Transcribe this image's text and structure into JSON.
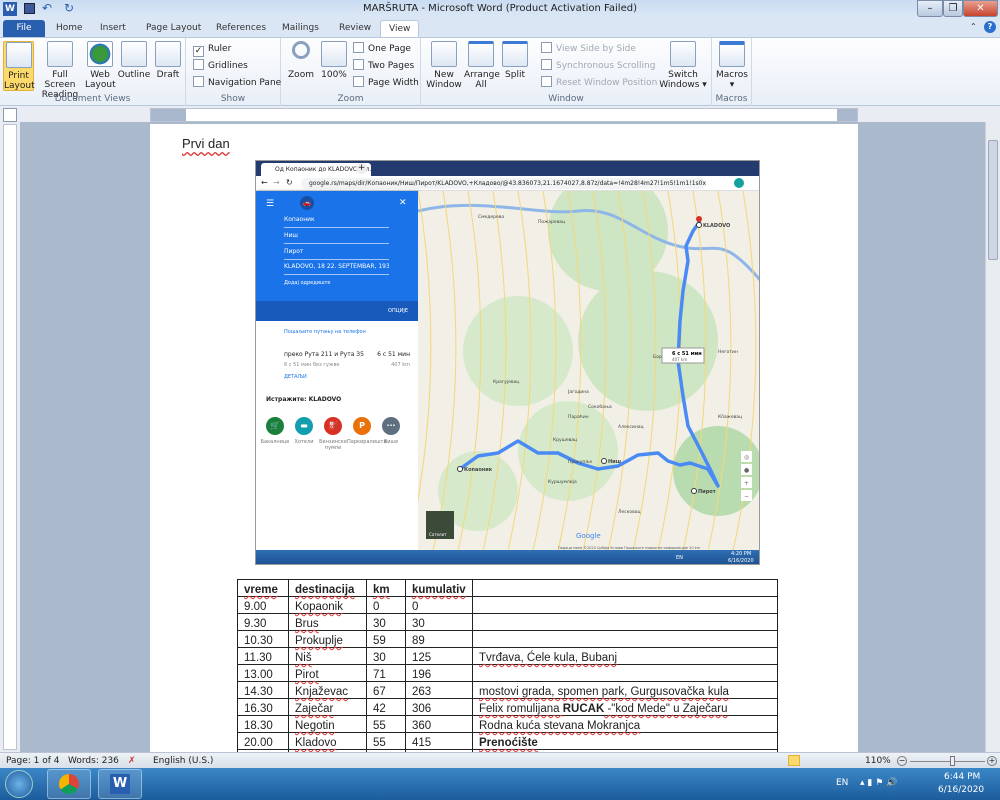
{
  "window": {
    "title": "MARŠRUTA  -  Microsoft Word (Product Activation Failed)",
    "minimize": "–",
    "restore": "❐",
    "close": "✕"
  },
  "ribbon_tabs": [
    {
      "label": "File"
    },
    {
      "label": "Home"
    },
    {
      "label": "Insert"
    },
    {
      "label": "Page Layout"
    },
    {
      "label": "References"
    },
    {
      "label": "Mailings"
    },
    {
      "label": "Review"
    },
    {
      "label": "View",
      "active": true
    }
  ],
  "ribbon": {
    "document_views": {
      "label": "Document Views",
      "buttons": [
        "Print Layout",
        "Full Screen Reading",
        "Web Layout",
        "Outline",
        "Draft"
      ],
      "selected": "Print Layout"
    },
    "show": {
      "label": "Show",
      "items": [
        {
          "label": "Ruler",
          "checked": true
        },
        {
          "label": "Gridlines",
          "checked": false
        },
        {
          "label": "Navigation Pane",
          "checked": false
        }
      ]
    },
    "zoom": {
      "label": "Zoom",
      "zoom": "Zoom",
      "percent": "100%",
      "one_page": "One Page",
      "two_pages": "Two Pages",
      "page_width": "Page Width"
    },
    "window": {
      "label": "Window",
      "new_window": "New Window",
      "arrange_all": "Arrange All",
      "split": "Split",
      "side_by_side": "View Side by Side",
      "sync_scroll": "Synchronous Scrolling",
      "reset_pos": "Reset Window Position",
      "switch": "Switch Windows"
    },
    "macros": {
      "label": "Macros",
      "macros": "Macros"
    }
  },
  "document": {
    "heading": "Prvi dan",
    "screenshot": {
      "tab_title": "Од Копаоник до KLADOVO, Кл...",
      "url": "google.rs/maps/dir/Копаоник/Ниш/Пирот/KLADOVO,+Кладово/@43.836073,21.1674027,8.87z/data=!4m28!4m27!1m5!1m1!1s0x47563c3a1dee3b07:0x71c8...",
      "waypoints": [
        "Копаоник",
        "Ниш",
        "Пирот",
        "KLADOVO, 18 22. SEPTEMBAR, 19320, ..."
      ],
      "add_destination": "Додај одредиште",
      "options": "ОПЦИЈЕ",
      "send_to_phone": "Пошаљите путању на телефон",
      "route": {
        "via": "преко Рута 211 и Рута 35",
        "time": "6 с 51 мин",
        "subtext": "6 с 51 мин без гужве",
        "distance": "407 km",
        "details": "ДЕТАЉИ"
      },
      "explore": "Истражите: KLADOVO",
      "categories": [
        {
          "label": "Бакалнице",
          "color": "#188038",
          "glyph": "🛒"
        },
        {
          "label": "Хотели",
          "color": "#129eaf",
          "glyph": "▬"
        },
        {
          "label": "Бензинске пумпе",
          "color": "#d93025",
          "glyph": "⛽"
        },
        {
          "label": "Паркиралишта",
          "color": "#e8710a",
          "glyph": "P"
        },
        {
          "label": "Више",
          "color": "#5f6f7f",
          "glyph": "···"
        }
      ],
      "route_badge": {
        "time": "6 с 51 мин",
        "distance": "407 km"
      },
      "places": [
        "KLADOVO",
        "Копаоник",
        "Ниш",
        "Пирот",
        "Смедерево",
        "Пожаревац",
        "Крагујевац",
        "Јагодина",
        "Параћин",
        "Бор",
        "Крушевац",
        "Алексинац",
        "Прокупље",
        "Куршумлија",
        "Лесковац",
        "Сокобања",
        "Неготин",
        "Кňажевац"
      ],
      "satellite": "Сателит",
      "map_footer": "Подаци мапе ©2020   Србија   Услови   Пошаљите повратне информације   20 km",
      "google": "Google",
      "taskbar_time": "4:20 PM",
      "taskbar_date": "6/16/2020",
      "taskbar_lang": "EN"
    },
    "table": {
      "headers": [
        "vreme",
        "destinacija",
        "km",
        "kumulativ",
        ""
      ],
      "rows": [
        [
          "9.00",
          "Kopaonik",
          "0",
          "0",
          ""
        ],
        [
          "9.30",
          "Brus",
          "30",
          "30",
          ""
        ],
        [
          "10.30",
          "Prokuplje",
          "59",
          "89",
          ""
        ],
        [
          "11.30",
          "Niš",
          "30",
          "125",
          "Tvrđava, Ćele kula,  Bubanj"
        ],
        [
          "13.00",
          "Pirot",
          "71",
          "196",
          ""
        ],
        [
          "14.30",
          "Knjaževac",
          "67",
          "263",
          "mostovi grada, spomen  park, Gurgusovačka  kula"
        ],
        [
          "16.30",
          "Zaječar",
          "42",
          "306",
          ""
        ],
        [
          "18.30",
          "Negotin",
          "55",
          "360",
          "Rodna  kuća stevana  Mokranjca"
        ],
        [
          "20.00",
          "Kladovo",
          "55",
          "415",
          ""
        ],
        [
          "",
          "",
          "",
          "",
          ""
        ]
      ],
      "zajecar_note": {
        "pre": "Felix romulijana ",
        "bold": "RUCAK",
        "post": " -\"kod Mede\" u Zaječaru"
      },
      "kladovo_note": "Prenoćište"
    }
  },
  "status": {
    "page": "Page: 1 of 4",
    "words": "Words: 236",
    "language": "English (U.S.)",
    "zoom": "110%",
    "zoom_percent": 110
  },
  "taskbar": {
    "lang": "EN",
    "time": "6:44 PM",
    "date": "6/16/2020"
  },
  "colors": {
    "word_blue": "#2a5fb0",
    "maps_blue": "#1a73e8",
    "route": "#4a8af4"
  }
}
